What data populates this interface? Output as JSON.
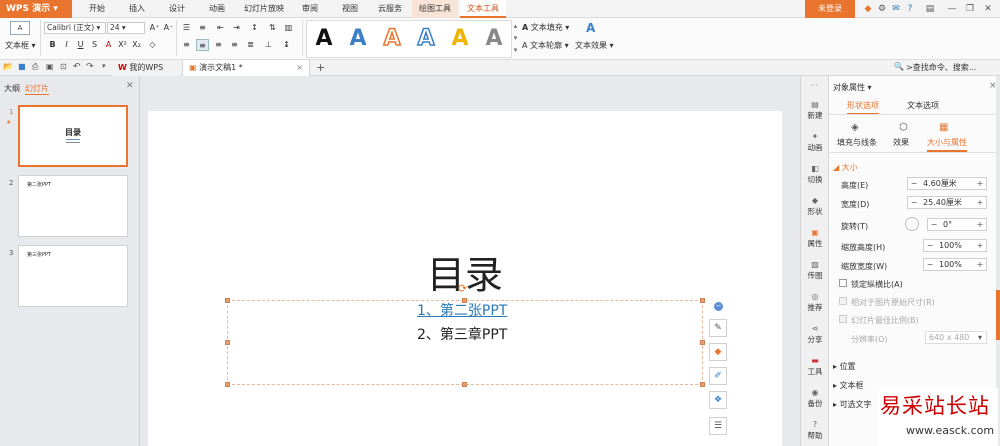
{
  "app": {
    "logo": "WPS 演示",
    "login": "未登录"
  },
  "menu": [
    "开始",
    "插入",
    "设计",
    "动画",
    "幻灯片放映",
    "审阅",
    "视图",
    "云服务",
    "绘图工具",
    "文本工具"
  ],
  "ribbon": {
    "textbox": "文本框",
    "font": "Calibri (正文)",
    "size": "24",
    "fill": "文本填充",
    "outline": "文本轮廓",
    "effect": "文本效果",
    "gallery_glyph": "A"
  },
  "tabbar": {
    "doc1": "我的WPS",
    "doc2": "演示文稿1 *",
    "search": "查找命令、搜索..."
  },
  "leftpanel": {
    "tab_outline": "大纲",
    "tab_slides": "幻灯片",
    "slides": [
      {
        "num": "1",
        "title": "目录"
      },
      {
        "num": "2",
        "title": "第二张PPT"
      },
      {
        "num": "3",
        "title": "第三张PPT"
      }
    ]
  },
  "slide": {
    "title": "目录",
    "item1": "1、第二张PPT",
    "item2": "2、第三章PPT"
  },
  "sidebar": [
    "新建",
    "动画",
    "切换",
    "形状",
    "属性",
    "传图",
    "推荐",
    "分享",
    "工具",
    "备份",
    "帮助"
  ],
  "props": {
    "title": "对象属性",
    "tab_shape": "形状选项",
    "tab_text": "文本选项",
    "sub1": "填充与线条",
    "sub2": "效果",
    "sub3": "大小与属性",
    "section_size": "大小",
    "height_label": "高度(E)",
    "height_val": "4.60厘米",
    "width_label": "宽度(D)",
    "width_val": "25.40厘米",
    "rotate_label": "旋转(T)",
    "rotate_val": "0°",
    "scale_h_label": "缩放高度(H)",
    "scale_h_val": "100%",
    "scale_w_label": "缩放宽度(W)",
    "scale_w_val": "100%",
    "lock_ratio": "锁定纵横比(A)",
    "rel_orig": "相对于图片原始尺寸(R)",
    "best_ratio": "幻灯片最佳比例(B)",
    "resolution_label": "分辨率(O)",
    "resolution_val": "640 x 480",
    "sec_pos": "位置",
    "sec_textbox": "文本框",
    "sec_alt": "可选文字"
  },
  "watermark": {
    "cn": "易采站长站",
    "url": "www.easck.com"
  },
  "colors": {
    "accent": "#e8742e",
    "link": "#2a7ab8"
  }
}
